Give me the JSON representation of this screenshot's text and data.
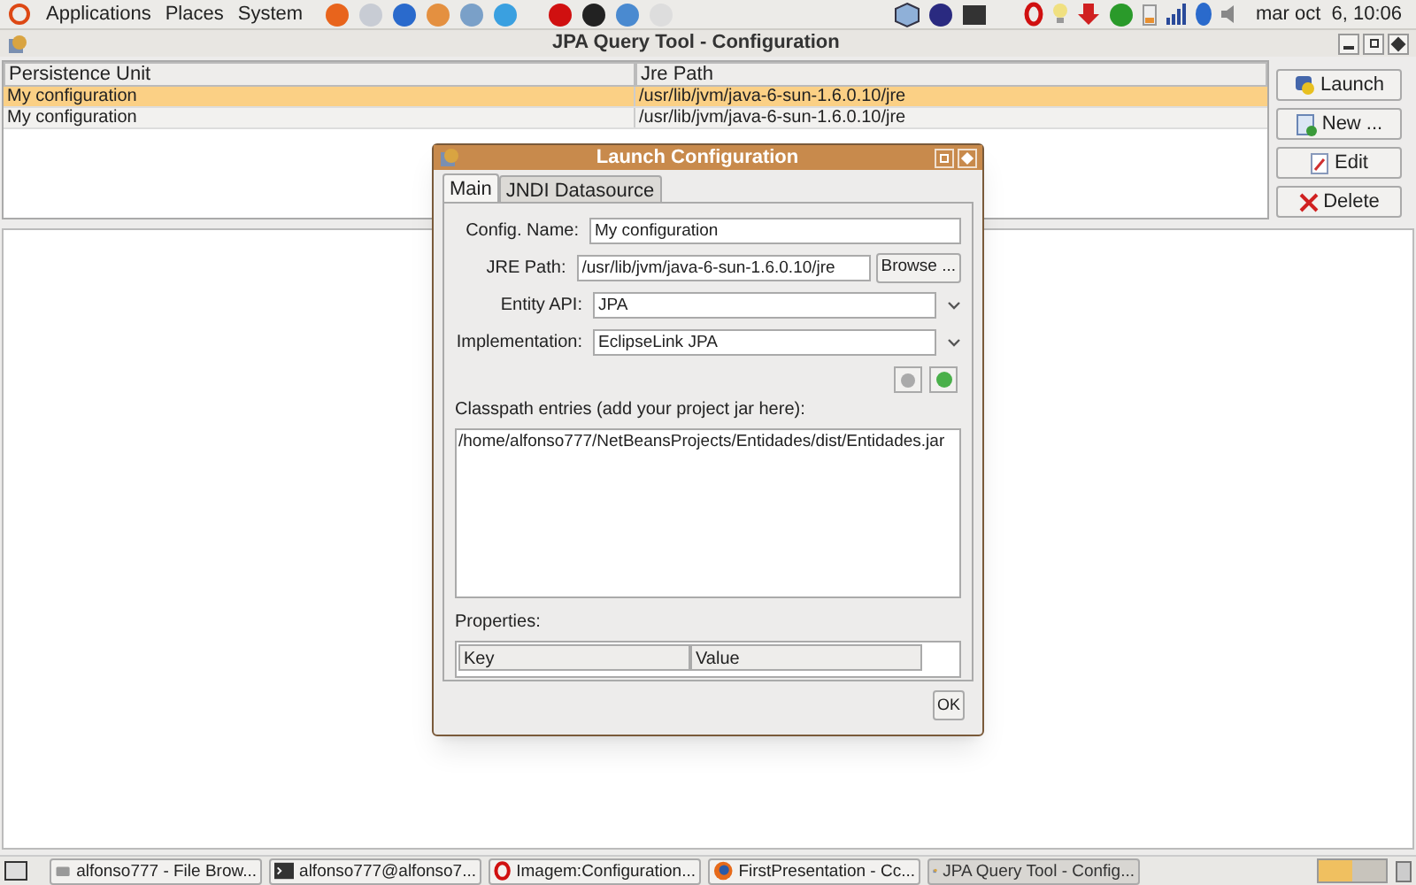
{
  "top_panel": {
    "menus": [
      "Applications",
      "Places",
      "System"
    ],
    "clock": "mar oct  6, 10:06"
  },
  "window": {
    "title": "JPA Query Tool - Configuration"
  },
  "table": {
    "columns": [
      "Persistence Unit",
      "Jre Path"
    ],
    "rows": [
      {
        "cells": [
          "My configuration",
          "/usr/lib/jvm/java-6-sun-1.6.0.10/jre"
        ],
        "selected": true
      },
      {
        "cells": [
          "My configuration",
          "/usr/lib/jvm/java-6-sun-1.6.0.10/jre"
        ],
        "selected": false
      }
    ]
  },
  "buttons": [
    {
      "label": "Launch",
      "kind": "launch"
    },
    {
      "label": "New ...",
      "kind": "new"
    },
    {
      "label": "Edit",
      "kind": "edit"
    },
    {
      "label": "Delete",
      "kind": "delete"
    }
  ],
  "dialog": {
    "title": "Launch Configuration",
    "tabs": [
      {
        "label": "Main",
        "selected": true
      },
      {
        "label": "JNDI Datasource",
        "selected": false
      }
    ],
    "fields": [
      {
        "label": "Config. Name:",
        "value": "My configuration",
        "kind": "text"
      },
      {
        "label": "JRE Path:",
        "value": "/usr/lib/jvm/java-6-sun-1.6.0.10/jre",
        "kind": "browse",
        "button": "Browse ..."
      },
      {
        "label": "Entity API:",
        "value": "JPA",
        "kind": "combo"
      },
      {
        "label": "Implementation:",
        "value": "EclipseLink JPA",
        "kind": "combo"
      }
    ],
    "classpath_label": "Classpath entries (add your project jar here):",
    "classpath_entries": [
      "/home/alfonso777/NetBeansProjects/Entidades/dist/Entidades.jar"
    ],
    "properties_label": "Properties:",
    "properties_columns": [
      "Key",
      "Value"
    ],
    "ok": "OK"
  },
  "taskbar": [
    {
      "label": "alfonso777 - File Brow...",
      "kind": "files",
      "selected": false
    },
    {
      "label": "alfonso777@alfonso7...",
      "kind": "terminal",
      "selected": false
    },
    {
      "label": "Imagem:Configuration...",
      "kind": "opera",
      "selected": false
    },
    {
      "label": "FirstPresentation - Cc...",
      "kind": "firefox",
      "selected": false
    },
    {
      "label": "JPA Query Tool - Config...",
      "kind": "app",
      "selected": true
    }
  ]
}
